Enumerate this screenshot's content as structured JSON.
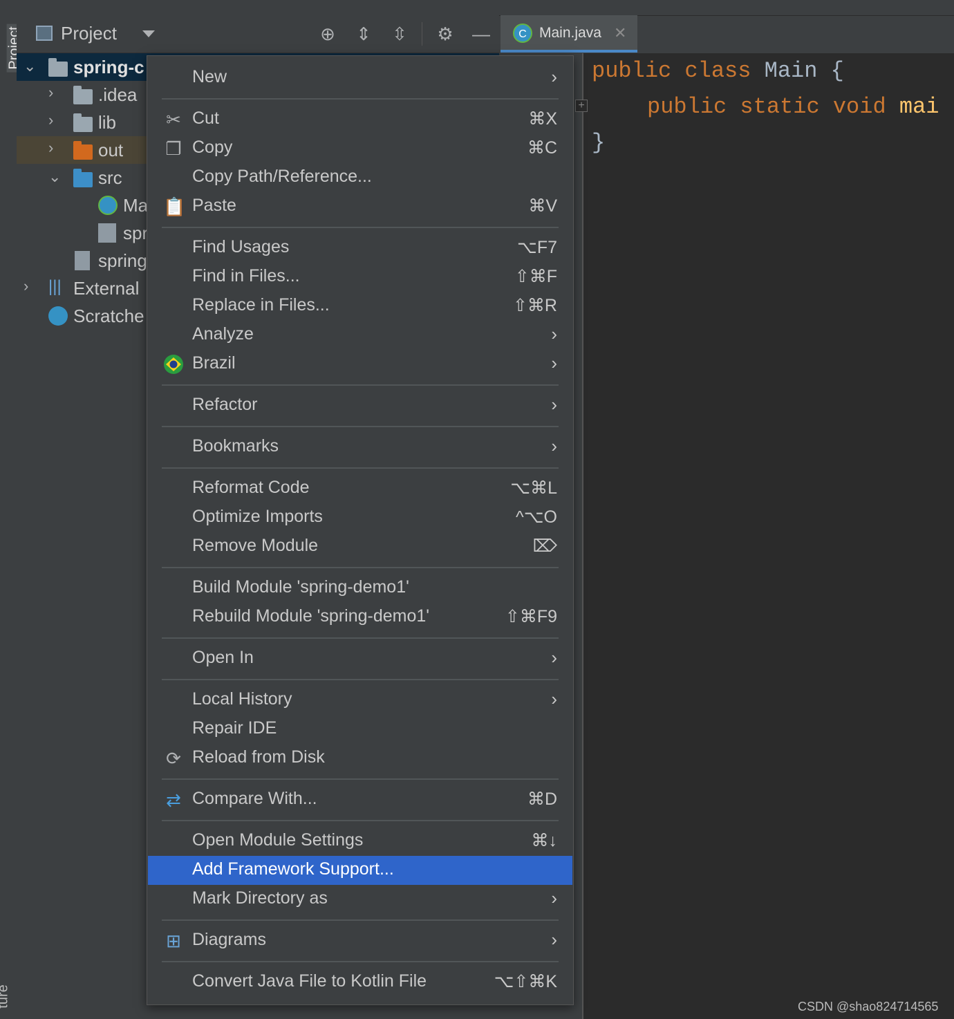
{
  "project_panel": {
    "stripe_label": "Project",
    "stripe_label_bottom": "ture",
    "title": "Project"
  },
  "tree": [
    {
      "label": "spring-c",
      "expanded": true,
      "bold": true
    },
    {
      "label": ".idea",
      "expanded": false
    },
    {
      "label": "lib",
      "expanded": false
    },
    {
      "label": "out",
      "expanded": false
    },
    {
      "label": "src",
      "expanded": true
    },
    {
      "label": "Ma"
    },
    {
      "label": "spr"
    },
    {
      "label": "spring"
    },
    {
      "label": "External",
      "expanded": false
    },
    {
      "label": "Scratche"
    }
  ],
  "editor": {
    "tab_label": "Main.java",
    "tab_icon_letter": "C",
    "code_line1": [
      "public",
      "class",
      "Main",
      "{"
    ],
    "code_line2": [
      "public",
      "static",
      "void",
      "mai"
    ],
    "code_line3": "}"
  },
  "menu": {
    "items": [
      {
        "label": "New",
        "shortcut": "",
        "submenu": true
      },
      {
        "label": "Cut",
        "shortcut": "⌘X",
        "icon": "scissors-icon"
      },
      {
        "label": "Copy",
        "shortcut": "⌘C",
        "icon": "copy-icon"
      },
      {
        "label": "Copy Path/Reference...",
        "shortcut": ""
      },
      {
        "label": "Paste",
        "shortcut": "⌘V",
        "icon": "clipboard-icon"
      },
      {
        "label": "Find Usages",
        "shortcut": "⌥F7"
      },
      {
        "label": "Find in Files...",
        "shortcut": "⇧⌘F"
      },
      {
        "label": "Replace in Files...",
        "shortcut": "⇧⌘R"
      },
      {
        "label": "Analyze",
        "shortcut": "",
        "submenu": true
      },
      {
        "label": "Brazil",
        "shortcut": "",
        "submenu": true,
        "icon": "brazil-flag-icon"
      },
      {
        "label": "Refactor",
        "shortcut": "",
        "submenu": true
      },
      {
        "label": "Bookmarks",
        "shortcut": "",
        "submenu": true
      },
      {
        "label": "Reformat Code",
        "shortcut": "⌥⌘L"
      },
      {
        "label": "Optimize Imports",
        "shortcut": "^⌥O"
      },
      {
        "label": "Remove Module",
        "shortcut": "⌦"
      },
      {
        "label": "Build Module 'spring-demo1'",
        "shortcut": ""
      },
      {
        "label": "Rebuild Module 'spring-demo1'",
        "shortcut": "⇧⌘F9"
      },
      {
        "label": "Open In",
        "shortcut": "",
        "submenu": true
      },
      {
        "label": "Local History",
        "shortcut": "",
        "submenu": true
      },
      {
        "label": "Repair IDE",
        "shortcut": ""
      },
      {
        "label": "Reload from Disk",
        "shortcut": "",
        "icon": "reload-icon"
      },
      {
        "label": "Compare With...",
        "shortcut": "⌘D",
        "icon": "compare-icon"
      },
      {
        "label": "Open Module Settings",
        "shortcut": "⌘↓"
      },
      {
        "label": "Add Framework Support...",
        "shortcut": "",
        "selected": true
      },
      {
        "label": "Mark Directory as",
        "shortcut": "",
        "submenu": true
      },
      {
        "label": "Diagrams",
        "shortcut": "",
        "submenu": true,
        "icon": "diagram-icon"
      },
      {
        "label": "Convert Java File to Kotlin File",
        "shortcut": "⌥⇧⌘K"
      }
    ]
  },
  "watermark": "CSDN @shao824714565",
  "colors": {
    "menu_bg": "#3c3f41",
    "selection": "#2f65ca",
    "editor_bg": "#2b2b2b",
    "keyword": "#cc7832",
    "method": "#ffc66d"
  }
}
